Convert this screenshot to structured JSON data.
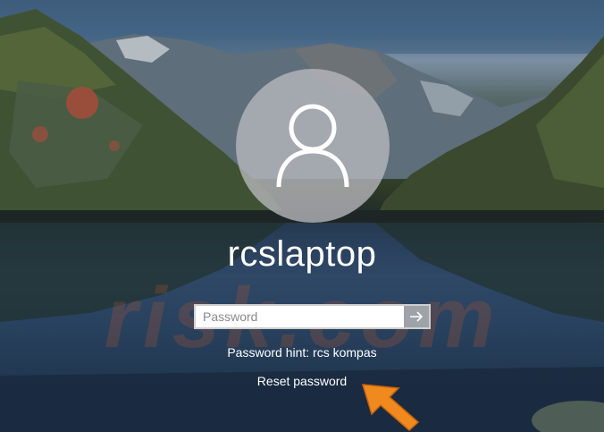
{
  "user": {
    "name": "rcslaptop"
  },
  "login": {
    "password_placeholder": "Password",
    "password_value": "",
    "hint_text": "Password hint: rcs kompas",
    "reset_label": "Reset password"
  },
  "watermark": {
    "text": "risk.com"
  },
  "colors": {
    "avatar_bg": "#b9b9be",
    "submit_button": "#9ea3a9",
    "arrow": "#f08a1e",
    "text": "#ffffff"
  },
  "icons": {
    "avatar": "user-silhouette-icon",
    "submit": "arrow-right-icon",
    "callout": "orange-arrow-icon"
  }
}
